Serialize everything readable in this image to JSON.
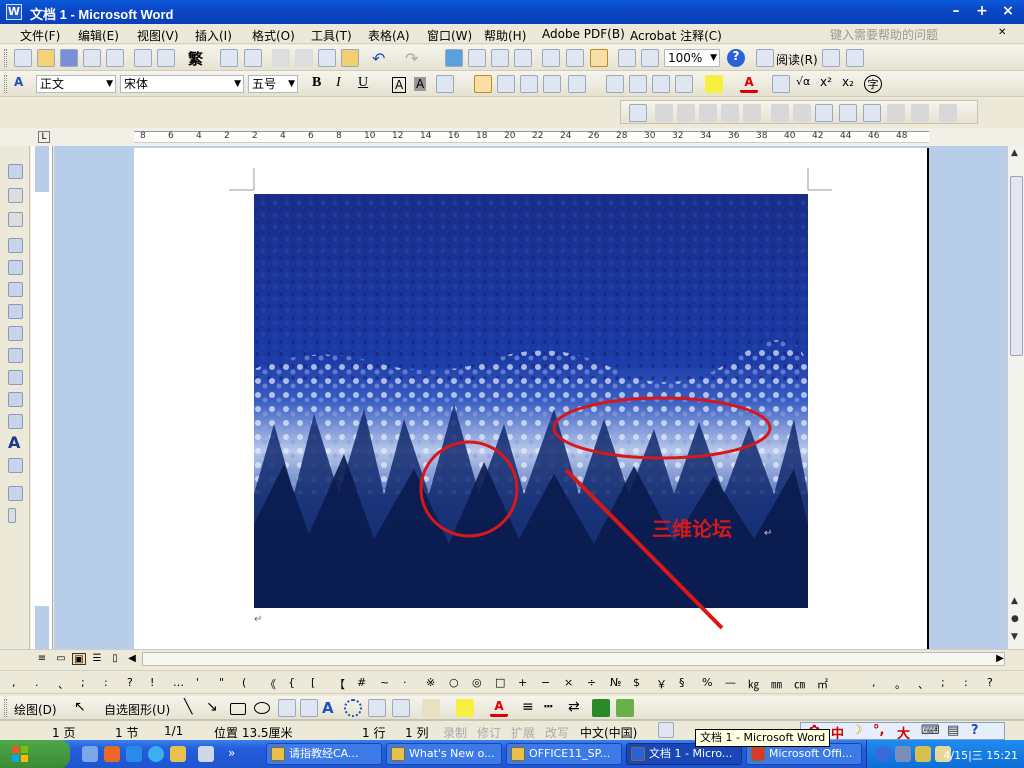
{
  "window": {
    "title": "文档 1 - Microsoft Word"
  },
  "menu": {
    "items": [
      "文件(F)",
      "编辑(E)",
      "视图(V)",
      "插入(I)",
      "格式(O)",
      "工具(T)",
      "表格(A)",
      "窗口(W)",
      "帮助(H)",
      "Adobe PDF(B)",
      "Acrobat 注释(C)"
    ],
    "help_placeholder": "键入需要帮助的问题"
  },
  "toolbar_standard": {
    "trad_char": "繁",
    "zoom": "100%",
    "read_label": "阅读(R)"
  },
  "toolbar_format": {
    "style": "正文",
    "font": "宋体",
    "size": "五号",
    "bold": "B",
    "italic": "I",
    "underline": "U",
    "char_border": "A",
    "char_shade": "A"
  },
  "ruler": {
    "numbers": [
      "8",
      "6",
      "4",
      "2",
      "2",
      "4",
      "6",
      "8",
      "10",
      "12",
      "14",
      "16",
      "18",
      "20",
      "22",
      "24",
      "26",
      "28",
      "30",
      "32",
      "34",
      "36",
      "38",
      "40",
      "42",
      "44",
      "46",
      "48"
    ]
  },
  "document": {
    "annotation_text": "三维论坛",
    "colors": {
      "annotation": "#d81818",
      "page_bg": "#b7cde8"
    }
  },
  "symbols": [
    ",",
    ".",
    "、",
    ";",
    ":",
    "?",
    "!",
    "…",
    "'",
    "\"",
    "(",
    "《",
    "{",
    "[",
    "【",
    "#",
    "~",
    "·",
    "※",
    "○",
    "◎",
    "□",
    "+",
    "−",
    "×",
    "÷",
    "№",
    "$",
    "￥",
    "§",
    "%",
    "—",
    "㎏",
    "㎜",
    "㎝",
    "㎡"
  ],
  "symbols_right": [
    ",",
    "。",
    "、",
    ";",
    ":",
    "?"
  ],
  "drawing": {
    "draw_label": "绘图(D)",
    "autoshape_label": "自选图形(U)"
  },
  "status": {
    "page": "1 页",
    "section": "1 节",
    "pages": "1/1",
    "position": "位置 13.5厘米",
    "line": "1 行",
    "column": "1 列",
    "rec": "录制",
    "trk": "修订",
    "ext": "扩展",
    "ovr": "改写",
    "lang": "中文(中国)"
  },
  "tooltip": "文档 1 - Microsoft Word",
  "ime": {
    "chars": [
      "中",
      "大"
    ]
  },
  "taskbar": {
    "tasks": [
      "请指教经CA...",
      "What's New o...",
      "OFFICE11_SP...",
      "文档 1 - Micro...",
      "Microsoft Offi..."
    ],
    "active_index": 3,
    "clock": "4/15|三 15:21"
  }
}
